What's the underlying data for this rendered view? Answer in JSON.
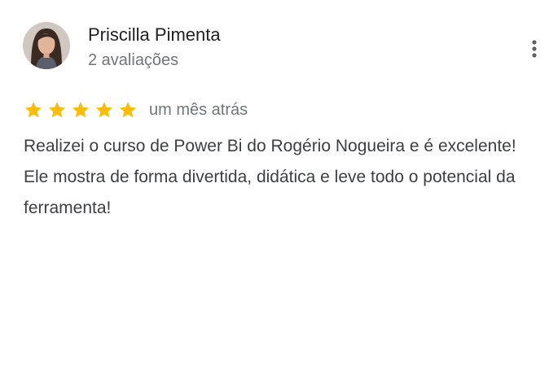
{
  "review": {
    "author_name": "Priscilla Pimenta",
    "author_meta": "2 avaliações",
    "rating": 5,
    "rating_max": 5,
    "date": "um mês atrás",
    "text": "Realizei o curso de Power Bi do Rogério Nogueira e é excelente! Ele mostra de forma divertida, didática e leve todo o potencial da ferramenta!"
  },
  "icons": {
    "avatar": "profile-photo",
    "star": "star-icon",
    "more": "more-vert-icon"
  },
  "colors": {
    "star": "#fbbc04",
    "name": "#202124",
    "meta": "#70757a",
    "body": "#3c4043"
  }
}
